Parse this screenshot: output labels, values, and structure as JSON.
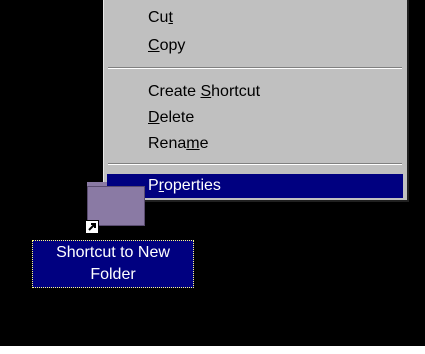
{
  "context_menu": {
    "items": [
      {
        "label_pre": "Cu",
        "label_ul": "t",
        "label_post": ""
      },
      {
        "label_pre": "",
        "label_ul": "C",
        "label_post": "opy"
      },
      {
        "label_pre": "Create ",
        "label_ul": "S",
        "label_post": "hortcut"
      },
      {
        "label_pre": "",
        "label_ul": "D",
        "label_post": "elete"
      },
      {
        "label_pre": "Rena",
        "label_ul": "m",
        "label_post": "e"
      },
      {
        "label_pre": "P",
        "label_ul": "r",
        "label_post": "operties"
      }
    ],
    "selected_index": 5
  },
  "desktop_icon": {
    "label_line1": "Shortcut to New",
    "label_line2": "Folder",
    "icon": "folder-shortcut-icon",
    "overlay_icon": "shortcut-arrow-icon"
  },
  "colors": {
    "desktop": "#000000",
    "menu_bg": "#c0c0c0",
    "selection": "#000080",
    "folder": "#8a7aa4"
  }
}
